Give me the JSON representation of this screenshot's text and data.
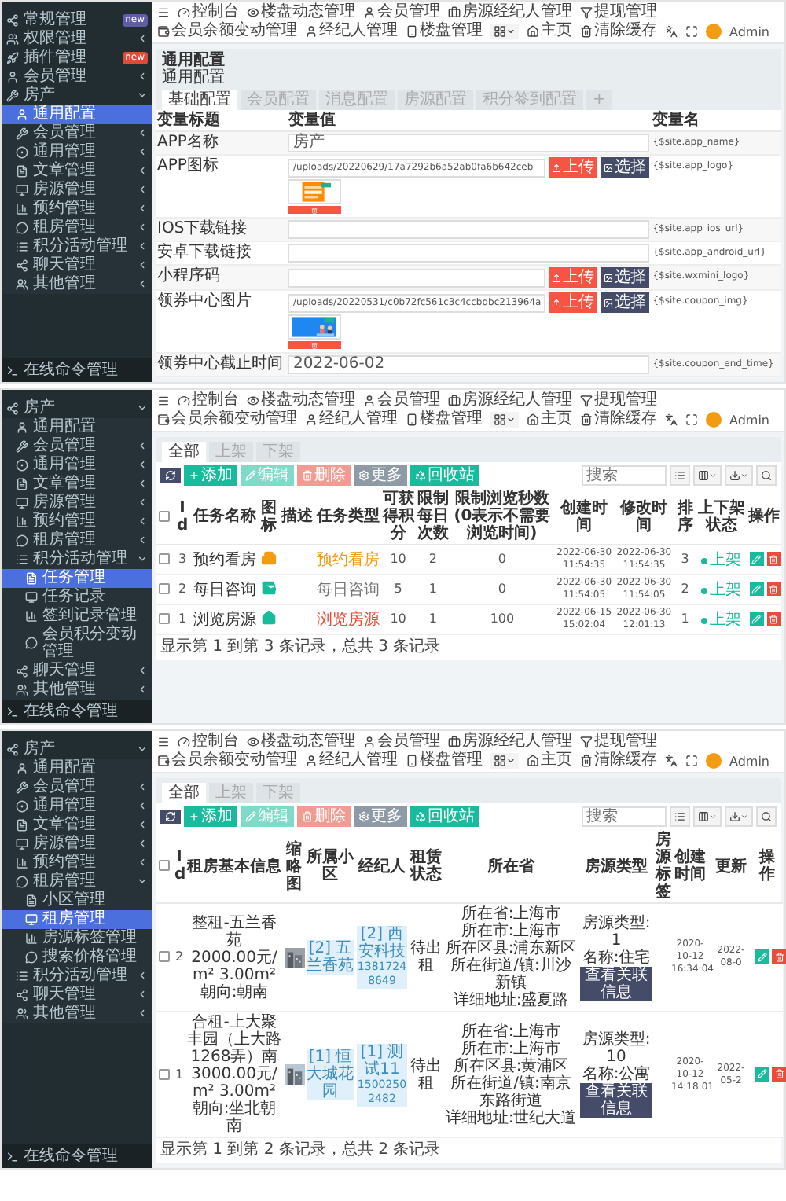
{
  "screens": [
    {
      "kind": "config",
      "sidebar": {
        "items": [
          {
            "label": "常规管理",
            "selected": false,
            "badge": {
              "text": "new",
              "color": "#605ca8"
            }
          },
          {
            "label": "权限管理",
            "selected": false,
            "expanded": false
          },
          {
            "label": "插件管理",
            "selected": false,
            "badge": {
              "text": "new",
              "color": "#dd4b39"
            }
          },
          {
            "label": "会员管理",
            "selected": false,
            "expanded": false
          },
          {
            "label": "房产",
            "selected": false,
            "expanded": true,
            "children": [
              {
                "label": "通用配置",
                "selected": true
              },
              {
                "label": "会员管理",
                "selected": false,
                "expanded": false
              },
              {
                "label": "通用管理",
                "selected": false,
                "expanded": false
              },
              {
                "label": "文章管理",
                "selected": false,
                "expanded": false
              },
              {
                "label": "房源管理",
                "selected": false,
                "expanded": false
              },
              {
                "label": "预约管理",
                "selected": false,
                "expanded": false
              },
              {
                "label": "租房管理",
                "selected": false,
                "expanded": false
              },
              {
                "label": "积分活动管理",
                "selected": false,
                "expanded": false
              },
              {
                "label": "聊天管理",
                "selected": false,
                "expanded": false
              },
              {
                "label": "其他管理",
                "selected": false,
                "expanded": false
              }
            ]
          }
        ],
        "footer_item": {
          "label": "在线命令管理",
          "selected": false
        }
      },
      "topbar": {
        "links": [
          "控制台",
          "楼盘动态管理",
          "会员管理",
          "房源经纪人管理",
          "提现管理",
          "会员余额变动管理",
          "经纪人管理",
          "楼盘管理"
        ],
        "home": "主页",
        "clear_cache": "清除缓存",
        "user": "Admin"
      },
      "title": "通用配置",
      "subtitle": "通用配置",
      "tabs": [
        {
          "label": "基础配置",
          "selected": true
        },
        {
          "label": "会员配置",
          "selected": false
        },
        {
          "label": "消息配置",
          "selected": false
        },
        {
          "label": "房源配置",
          "selected": false
        },
        {
          "label": "积分签到配置",
          "selected": false
        }
      ],
      "add_tab": "+",
      "columns": [
        "变量标题",
        "变量值",
        "变量名"
      ],
      "rows": [
        {
          "title": "APP名称",
          "kind": "text",
          "value": "房产",
          "name": "{$site.app_name}"
        },
        {
          "title": "APP图标",
          "kind": "upload_preview",
          "value": "/uploads/20220629/17a7292b6a52ab0fa6b642ceb",
          "upload_label": "上传",
          "choose_label": "选择",
          "name": "{$site.app_logo}"
        },
        {
          "title": "IOS下载链接",
          "kind": "text",
          "name": "{$site.app_ios_url}"
        },
        {
          "title": "安卓下载链接",
          "kind": "text",
          "name": "{$site.app_android_url}"
        },
        {
          "title": "小程序码",
          "kind": "upload",
          "upload_label": "上传",
          "choose_label": "选择",
          "name": "{$site.wxmini_logo}"
        },
        {
          "title": "领券中心图片",
          "kind": "upload_preview",
          "value": "/uploads/20220531/c0b72fc561c3c4ccbdbc213964a",
          "upload_label": "上传",
          "choose_label": "选择",
          "name": "{$site.coupon_img}"
        },
        {
          "title": "领券中心截止时间",
          "kind": "text",
          "value": "2022-06-02",
          "name": "{$site.coupon_end_time}"
        }
      ]
    },
    {
      "kind": "tasks",
      "sidebar": {
        "items": [
          {
            "label": "房产",
            "selected": false,
            "expanded": true,
            "children": [
              {
                "label": "通用配置",
                "selected": false
              },
              {
                "label": "会员管理",
                "selected": false,
                "expanded": false
              },
              {
                "label": "通用管理",
                "selected": false,
                "expanded": false
              },
              {
                "label": "文章管理",
                "selected": false,
                "expanded": false
              },
              {
                "label": "房源管理",
                "selected": false,
                "expanded": false
              },
              {
                "label": "预约管理",
                "selected": false,
                "expanded": false
              },
              {
                "label": "租房管理",
                "selected": false,
                "expanded": false
              },
              {
                "label": "积分活动管理",
                "selected": false,
                "expanded": true,
                "children": [
                  {
                    "label": "任务管理",
                    "selected": true
                  },
                  {
                    "label": "任务记录",
                    "selected": false
                  },
                  {
                    "label": "签到记录管理",
                    "selected": false
                  },
                  {
                    "label": "会员积分变动管理",
                    "selected": false
                  }
                ]
              },
              {
                "label": "聊天管理",
                "selected": false,
                "expanded": false
              },
              {
                "label": "其他管理",
                "selected": false,
                "expanded": false
              }
            ]
          }
        ],
        "footer_item": {
          "label": "在线命令管理",
          "selected": false
        }
      },
      "topbar": {
        "links": [
          "控制台",
          "楼盘动态管理",
          "会员管理",
          "房源经纪人管理",
          "提现管理",
          "会员余额变动管理",
          "经纪人管理",
          "楼盘管理"
        ],
        "home": "主页",
        "clear_cache": "清除缓存",
        "user": "Admin"
      },
      "tabs": [
        {
          "label": "全部",
          "selected": true
        },
        {
          "label": "上架",
          "selected": false
        },
        {
          "label": "下架",
          "selected": false
        }
      ],
      "toolbar": [
        {
          "kind": "refresh",
          "disabled": false
        },
        {
          "kind": "add",
          "label": "添加",
          "disabled": false
        },
        {
          "kind": "edit",
          "label": "编辑",
          "disabled": true
        },
        {
          "kind": "delete",
          "label": "删除",
          "disabled": true
        },
        {
          "kind": "more",
          "label": "更多",
          "disabled": false
        },
        {
          "kind": "recycle",
          "label": "回收站",
          "disabled": false
        }
      ],
      "search_placeholder": "搜索",
      "all_checked": false,
      "columns": [
        "Id",
        "任务名称",
        "图标",
        "描述",
        "任务类型",
        "可获得积分",
        "限制每日次数",
        "限制浏览秒数(0表示不需要浏览时间)",
        "创建时间",
        "修改时间",
        "排序",
        "上下架状态",
        "操作"
      ],
      "rows": [
        {
          "checked": false,
          "id": "3",
          "name": "预约看房",
          "type": {
            "label": "预约看房",
            "color": "#f39c12"
          },
          "points": "10",
          "daily_limit": "2",
          "seconds": "0",
          "created": "2022-06-30 11:54:35",
          "updated": "2022-06-30 11:54:35",
          "sort": "3",
          "status": {
            "label": "上架",
            "on": true
          }
        },
        {
          "checked": false,
          "id": "2",
          "name": "每日咨询",
          "type": {
            "label": "每日咨询",
            "color": "#777777"
          },
          "points": "5",
          "daily_limit": "1",
          "seconds": "0",
          "created": "2022-06-30 11:54:05",
          "updated": "2022-06-30 11:54:05",
          "sort": "2",
          "status": {
            "label": "上架",
            "on": true
          }
        },
        {
          "checked": false,
          "id": "1",
          "name": "浏览房源",
          "type": {
            "label": "浏览房源",
            "color": "#e74c3c"
          },
          "points": "10",
          "daily_limit": "1",
          "seconds": "100",
          "created": "2022-06-15 15:02:04",
          "updated": "2022-06-30 12:01:13",
          "sort": "1",
          "status": {
            "label": "上架",
            "on": true
          }
        }
      ],
      "footer": "显示第 1 到第 3 条记录，总共 3 条记录"
    },
    {
      "kind": "rentals",
      "sidebar": {
        "items": [
          {
            "label": "房产",
            "selected": false,
            "expanded": true,
            "children": [
              {
                "label": "通用配置",
                "selected": false
              },
              {
                "label": "会员管理",
                "selected": false,
                "expanded": false
              },
              {
                "label": "通用管理",
                "selected": false,
                "expanded": false
              },
              {
                "label": "文章管理",
                "selected": false,
                "expanded": false
              },
              {
                "label": "房源管理",
                "selected": false,
                "expanded": false
              },
              {
                "label": "预约管理",
                "selected": false,
                "expanded": false
              },
              {
                "label": "租房管理",
                "selected": false,
                "expanded": true,
                "children": [
                  {
                    "label": "小区管理",
                    "selected": false
                  },
                  {
                    "label": "租房管理",
                    "selected": true
                  },
                  {
                    "label": "房源标签管理",
                    "selected": false
                  },
                  {
                    "label": "搜索价格管理",
                    "selected": false
                  }
                ]
              },
              {
                "label": "积分活动管理",
                "selected": false,
                "expanded": false
              },
              {
                "label": "聊天管理",
                "selected": false,
                "expanded": false
              },
              {
                "label": "其他管理",
                "selected": false,
                "expanded": false
              }
            ]
          }
        ],
        "footer_item": {
          "label": "在线命令管理",
          "selected": false
        }
      },
      "topbar": {
        "links": [
          "控制台",
          "楼盘动态管理",
          "会员管理",
          "房源经纪人管理",
          "提现管理",
          "会员余额变动管理",
          "经纪人管理",
          "楼盘管理"
        ],
        "home": "主页",
        "clear_cache": "清除缓存",
        "user": "Admin"
      },
      "tabs": [
        {
          "label": "全部",
          "selected": true
        },
        {
          "label": "上架",
          "selected": false
        },
        {
          "label": "下架",
          "selected": false
        }
      ],
      "toolbar": [
        {
          "kind": "refresh",
          "disabled": false
        },
        {
          "kind": "add",
          "label": "添加",
          "disabled": false
        },
        {
          "kind": "edit",
          "label": "编辑",
          "disabled": true
        },
        {
          "kind": "delete",
          "label": "删除",
          "disabled": true
        },
        {
          "kind": "more",
          "label": "更多",
          "disabled": false
        },
        {
          "kind": "recycle",
          "label": "回收站",
          "disabled": false
        }
      ],
      "search_placeholder": "搜索",
      "all_checked": false,
      "columns": [
        "Id",
        "租房基本信息",
        "缩略图",
        "所属小区",
        "经纪人",
        "租赁状态",
        "所在省",
        "房源类型",
        "房源标签",
        "创建时间",
        "更新",
        "操作"
      ],
      "rows": [
        {
          "checked": false,
          "id": "2",
          "info": [
            "整租-五兰香苑",
            "2000.00元/m² 3.00m²",
            "朝向:朝南"
          ],
          "community": "[2] 五兰香苑",
          "agent": {
            "name": "[2] 西安科技",
            "phone": "13817248649"
          },
          "status": "待出租",
          "address": [
            "所在省:上海市",
            "所在市:上海市",
            "所在区县:浦东新区",
            "所在街道/镇:川沙新镇",
            "详细地址:盛夏路"
          ],
          "house_type": [
            "房源类型:1",
            "名称:住宅"
          ],
          "detail_button": "查看关联信息",
          "created": "2020-10-12 16:34:04",
          "updated": "2022-08-0"
        },
        {
          "checked": false,
          "id": "1",
          "info": [
            "合租-上大聚丰园（上大路1268弄）南",
            "3000.00元/m² 3.00m²",
            "朝向:坐北朝南"
          ],
          "community": "[1] 恒大城花园",
          "agent": {
            "name": "[1] 测试11",
            "phone": "15002502482"
          },
          "status": "待出租",
          "address": [
            "所在省:上海市",
            "所在市:上海市",
            "所在区县:黄浦区",
            "所在街道/镇:南京东路街道",
            "详细地址:世纪大道"
          ],
          "house_type": [
            "房源类型:10",
            "名称:公寓"
          ],
          "detail_button": "查看关联信息",
          "created": "2020-10-12 14:18:01",
          "updated": "2022-05-2"
        }
      ],
      "footer": "显示第 1 到第 2 条记录，总共 2 条记录"
    }
  ]
}
